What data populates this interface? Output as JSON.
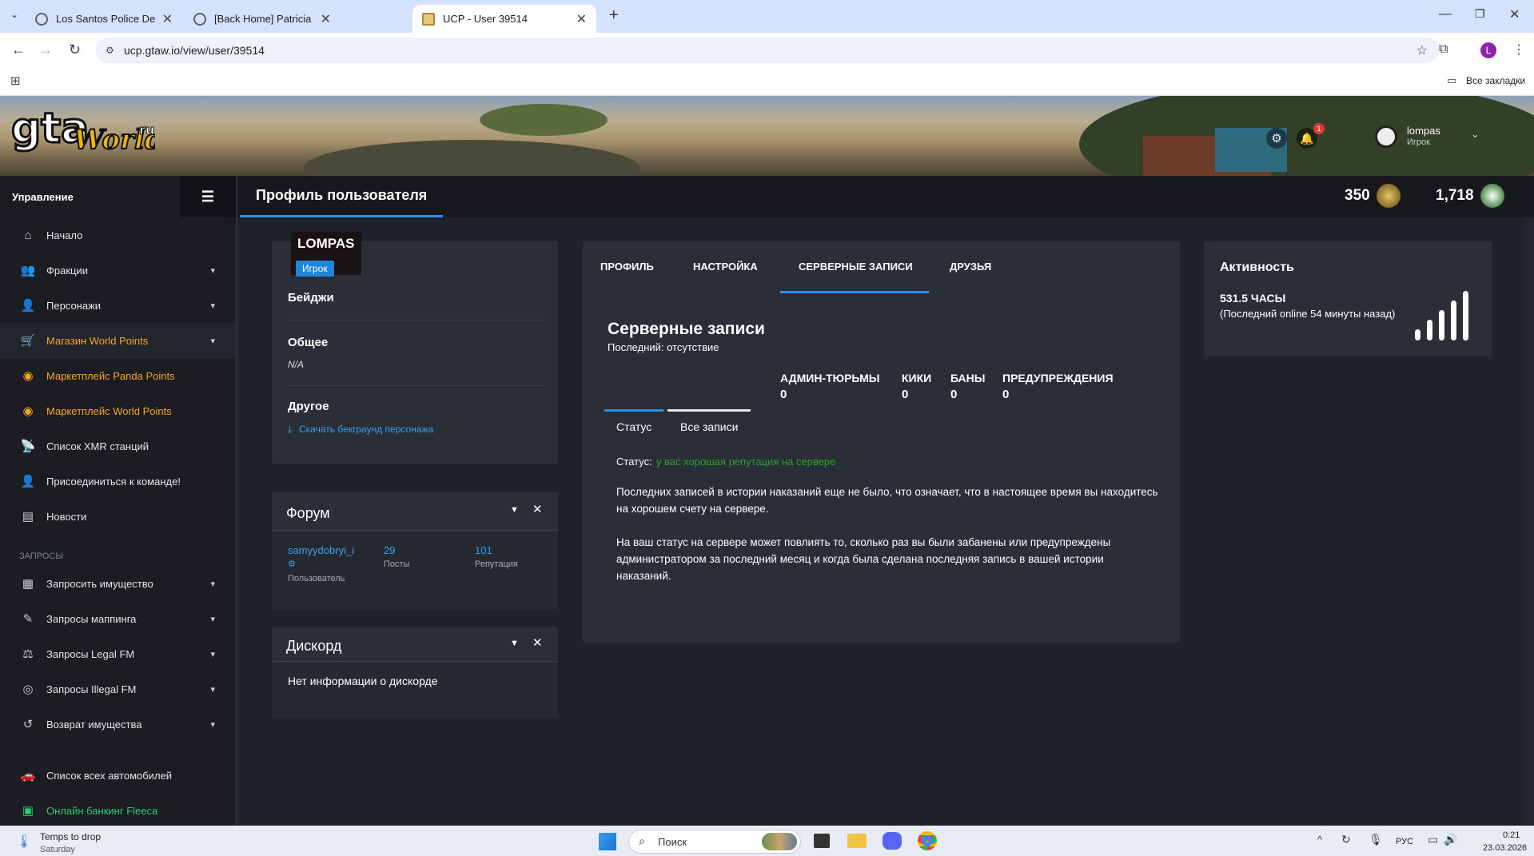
{
  "browser": {
    "tabs": [
      {
        "title": "Los Santos Police Department -"
      },
      {
        "title": "[Back Home] Patricia Vella (kala"
      },
      {
        "title": "UCP - User 39514"
      }
    ],
    "url": "ucp.gtaw.io/view/user/39514",
    "all_bookmarks": "Все закладки",
    "profile_letter": "L"
  },
  "header": {
    "user_name": "lompas",
    "user_role": "Игрок",
    "notif_count": "1"
  },
  "sidebar": {
    "title": "Управление",
    "items": [
      {
        "label": "Начало",
        "icon": "home-icon"
      },
      {
        "label": "Фракции",
        "icon": "users-icon"
      },
      {
        "label": "Персонажи",
        "icon": "user-icon"
      },
      {
        "label": "Магазин World Points",
        "icon": "cart-icon"
      },
      {
        "label": "Маркетплейс Panda Points",
        "icon": "coins-icon"
      },
      {
        "label": "Маркетплейс World Points",
        "icon": "coins-icon"
      },
      {
        "label": "Список XMR станций",
        "icon": "antenna-icon"
      },
      {
        "label": "Присоединиться к команде!",
        "icon": "user-plus-icon"
      },
      {
        "label": "Новости",
        "icon": "news-icon"
      }
    ],
    "section_label": "ЗАПРОСЫ",
    "requests": [
      {
        "label": "Запросить имущество",
        "icon": "building-icon"
      },
      {
        "label": "Запросы маппинга",
        "icon": "brush-icon"
      },
      {
        "label": "Запросы Legal FM",
        "icon": "scale-icon"
      },
      {
        "label": "Запросы Illegal FM",
        "icon": "mask-icon"
      },
      {
        "label": "Возврат имущества",
        "icon": "undo-icon"
      }
    ],
    "bottom": [
      {
        "label": "Список всех автомобилей",
        "icon": "car-icon"
      },
      {
        "label": "Онлайн банкинг Fleeca",
        "icon": "bank-icon"
      }
    ]
  },
  "main": {
    "page_title": "Профиль пользователя",
    "world_points": "350",
    "panda_points": "1,718",
    "profile": {
      "name": "LOMPAS",
      "role_badge": "Игрок",
      "badges_label": "Бейджи",
      "general_label": "Общее",
      "general_value": "N/A",
      "other_label": "Другое",
      "download_link": "Скачать бекграунд персонажа"
    },
    "forum": {
      "title": "Форум",
      "username": "samyydobryi_i",
      "user_label": "Пользователь",
      "posts_value": "29",
      "posts_label": "Посты",
      "rep_value": "101",
      "rep_label": "Репутация"
    },
    "discord": {
      "title": "Дискорд",
      "text": "Нет информации о дискорде"
    },
    "tabs": [
      "ПРОФИЛЬ",
      "НАСТРОЙКА",
      "СЕРВЕРНЫЕ ЗАПИСИ",
      "ДРУЗЬЯ"
    ],
    "records": {
      "title": "Серверные записи",
      "last": "Последний: отсутствие",
      "stats": [
        {
          "label": "АДМИН-ТЮРЬМЫ",
          "value": "0"
        },
        {
          "label": "КИКИ",
          "value": "0"
        },
        {
          "label": "БАНЫ",
          "value": "0"
        },
        {
          "label": "ПРЕДУПРЕЖДЕНИЯ",
          "value": "0"
        }
      ],
      "subtabs": [
        "Статус",
        "Все записи"
      ],
      "status_label": "Статус:",
      "status_value": "у вас хорошая репутация на сервере",
      "para1": "Последних записей в истории наказаний еще не было, что означает, что в настоящее время вы находитесь на хорошем счету на сервере.",
      "para2": "На ваш статус на сервере может повлиять то, сколько раз вы были забанены или предупреждены администратором за последний месяц и когда была сделана последняя запись в вашей истории наказаний."
    },
    "activity": {
      "title": "Активность",
      "hours": "531.5 ЧАСЫ",
      "last_online": "(Последний online 54 минуты назад)"
    }
  },
  "taskbar": {
    "weather_title": "Temps to drop",
    "weather_sub": "Saturday",
    "search": "Поиск",
    "lang": "РУС",
    "time": "0:21",
    "date": "23.03.2026"
  },
  "colors": {
    "accent": "#2f8dee",
    "orange": "#f5a623",
    "green": "#2ecc71",
    "card": "#2a2e36",
    "bg": "#1e222b"
  }
}
